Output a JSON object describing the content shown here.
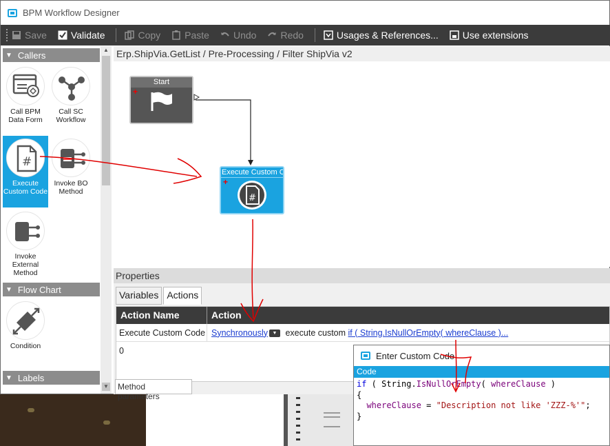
{
  "window": {
    "title": "BPM Workflow Designer"
  },
  "toolbar": {
    "save": "Save",
    "validate": "Validate",
    "copy": "Copy",
    "paste": "Paste",
    "undo": "Undo",
    "redo": "Redo",
    "usages": "Usages & References...",
    "extensions": "Use extensions"
  },
  "toolbox": {
    "callers_header": "Callers",
    "items": [
      {
        "label": "Call BPM Data Form"
      },
      {
        "label": "Call SC Workflow"
      },
      {
        "label": "Execute Custom Code"
      },
      {
        "label": "Invoke BO Method"
      },
      {
        "label": "Invoke External Method"
      }
    ],
    "flowchart_header": "Flow Chart",
    "condition": "Condition",
    "labels_header": "Labels"
  },
  "canvas": {
    "breadcrumb": "Erp.ShipVia.GetList / Pre-Processing / Filter ShipVia v2",
    "start_node": "Start",
    "exec_node": "Execute Custom Co"
  },
  "properties": {
    "header": "Properties",
    "tabs": [
      "Variables",
      "Actions"
    ],
    "columns": [
      "Action Name",
      "Action"
    ],
    "row": {
      "name": "Execute Custom Code 0",
      "mode": "Synchronously",
      "text": "execute custom",
      "code_link": "if ( String.IsNullOrEmpty( whereClause )..."
    },
    "method_params": "Method parameters"
  },
  "dialog": {
    "title": "Enter Custom Code",
    "tab": "Code",
    "code": {
      "l1_kw": "if",
      "l1_a": " ( String.",
      "l1_fn": "IsNullOrEmpty",
      "l1_b": "( ",
      "l1_id": "whereClause",
      "l1_c": " )",
      "l2": "{",
      "l3_id": "whereClause",
      "l3_a": " = ",
      "l3_str": "\"Description not like 'ZZZ-%'\"",
      "l3_b": ";",
      "l4": "}"
    }
  },
  "colors": {
    "accent": "#1aa3e0",
    "toolbar": "#3b3b3b",
    "annotation": "#e00000"
  }
}
